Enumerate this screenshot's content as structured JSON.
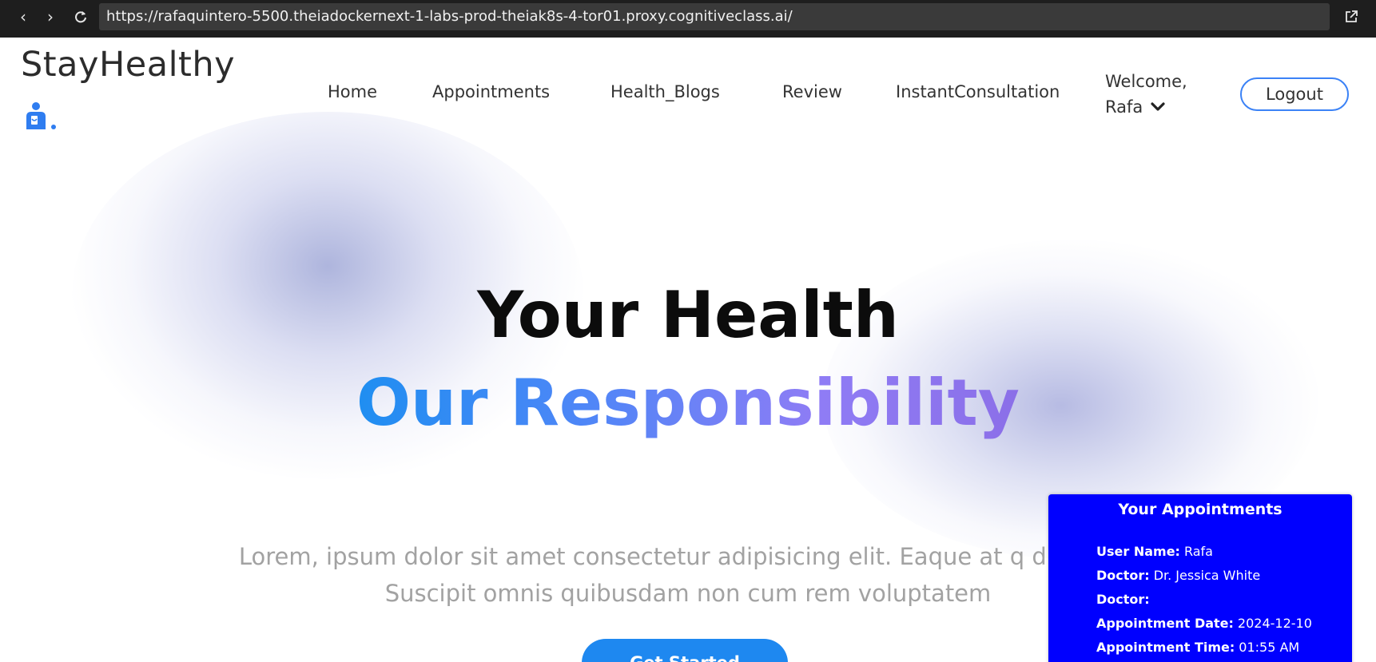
{
  "browser": {
    "url": "https://rafaquintero-5500.theiadockernext-1-labs-prod-theiak8s-4-tor01.proxy.cognitiveclass.ai/"
  },
  "header": {
    "logo": "StayHealthy",
    "nav": [
      "Home",
      "Appointments",
      "Health_Blogs",
      "Review",
      "InstantConsultation"
    ],
    "welcome": "Welcome,",
    "user": "Rafa",
    "logout": "Logout"
  },
  "hero": {
    "title_line1": "Your Health",
    "title_line2": "Our Responsibility",
    "description": "Lorem, ipsum dolor sit amet consectetur adipisicing elit. Eaque at q ducimus. Suscipit omnis quibusdam non cum rem voluptatem",
    "cta": "Get Started"
  },
  "appointment": {
    "title": "Your Appointments",
    "rows": [
      {
        "label": "User Name:",
        "value": "Rafa"
      },
      {
        "label": "Doctor:",
        "value": "Dr. Jessica White"
      },
      {
        "label": "Doctor:",
        "value": ""
      },
      {
        "label": "Appointment Date:",
        "value": "2024-12-10"
      },
      {
        "label": "Appointment Time:",
        "value": "01:55 AM"
      }
    ]
  },
  "colors": {
    "accent": "#1e88f0",
    "card": "#0000ff",
    "gradient_start": "#1f8ef1",
    "gradient_end": "#8b6fe8"
  },
  "icons": [
    "back-icon",
    "forward-icon",
    "reload-icon",
    "external-link-icon",
    "doctor-icon",
    "chevron-down-icon"
  ]
}
